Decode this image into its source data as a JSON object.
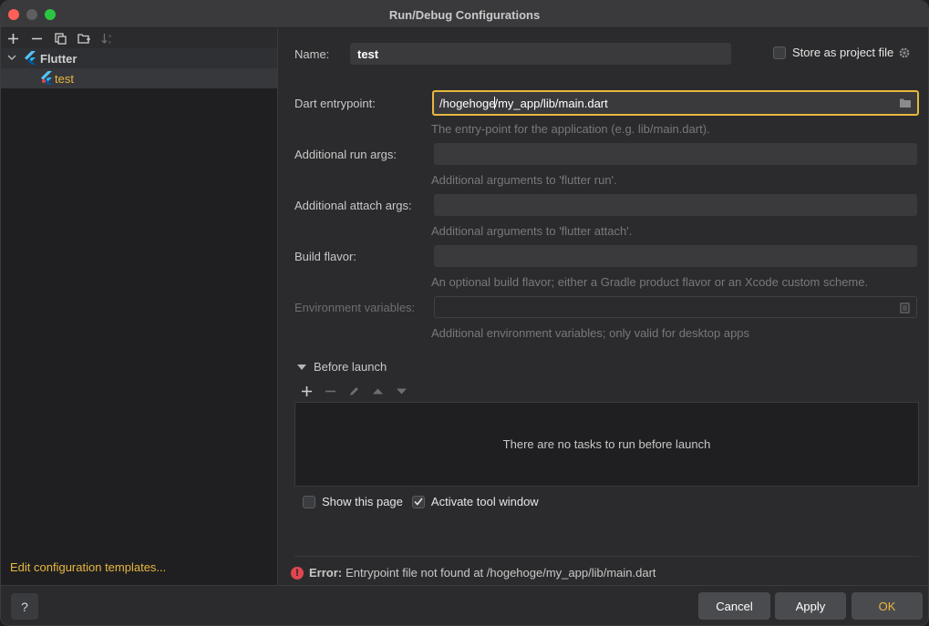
{
  "window": {
    "title": "Run/Debug Configurations"
  },
  "left_panel": {
    "toolbar": {
      "icons": [
        "plus-icon",
        "minus-icon",
        "copy-icon",
        "new-folder-icon",
        "sort-icon"
      ]
    },
    "tree": {
      "group_label": "Flutter",
      "item_label": "test"
    },
    "edit_templates_link": "Edit configuration templates..."
  },
  "form": {
    "name_label": "Name:",
    "name_value": "test",
    "store_as_project_file_label": "Store as project file",
    "store_as_project_file_checked": false,
    "entrypoint_label": "Dart entrypoint:",
    "entrypoint_value_before_caret": "/hogehoge",
    "entrypoint_value_after_caret": "/my_app/lib/main.dart",
    "entrypoint_hint": "The entry-point for the application (e.g. lib/main.dart).",
    "run_args_label": "Additional run args:",
    "run_args_hint": "Additional arguments to 'flutter run'.",
    "attach_args_label": "Additional attach args:",
    "attach_args_hint": "Additional arguments to 'flutter attach'.",
    "build_flavor_label": "Build flavor:",
    "build_flavor_hint": "An optional build flavor; either a Gradle product flavor or an Xcode custom scheme.",
    "env_vars_label": "Environment variables:",
    "env_vars_hint": "Additional environment variables; only valid for desktop apps"
  },
  "before_launch": {
    "title": "Before launch",
    "empty_text": "There are no tasks to run before launch",
    "show_this_page_label": "Show this page",
    "show_this_page_checked": false,
    "activate_tool_window_label": "Activate tool window",
    "activate_tool_window_checked": true
  },
  "error": {
    "label": "Error:",
    "message": "Entrypoint file not found at /hogehoge/my_app/lib/main.dart"
  },
  "footer": {
    "help_label": "?",
    "cancel_label": "Cancel",
    "apply_label": "Apply",
    "ok_label": "OK"
  },
  "colors": {
    "accent": "#e8b73f",
    "error": "#e0464f",
    "background": "#2b2b2d",
    "panel_dark": "#1f1f21"
  }
}
